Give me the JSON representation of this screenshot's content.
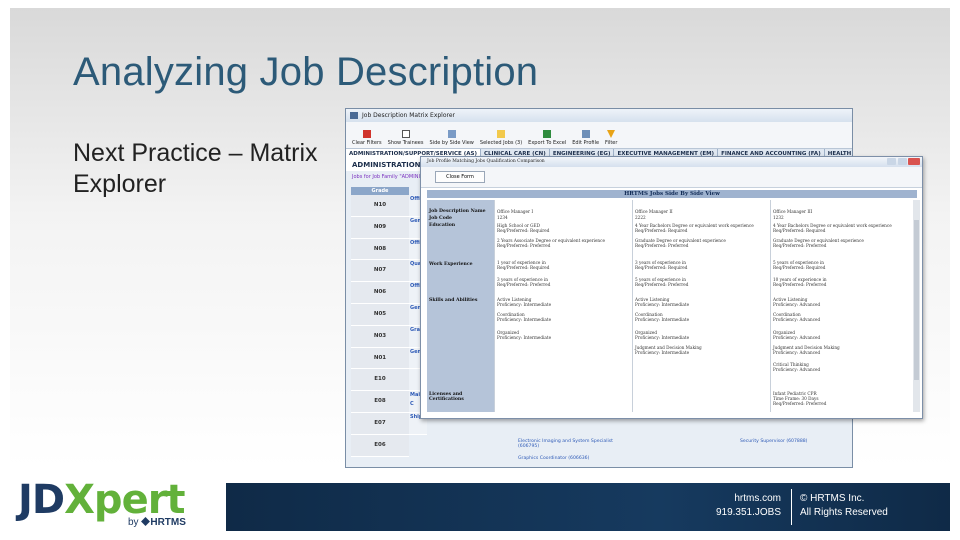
{
  "slide": {
    "title": "Analyzing Job Description",
    "subtitle": "Next Practice – Matrix Explorer"
  },
  "window": {
    "title": "Job Description Matrix Explorer",
    "toolbar": [
      "Clear Filters",
      "Show Trainees",
      "Side by Side View",
      "Selected Jobs (3)",
      "Export To Excel",
      "Edit Profile",
      "Filter"
    ],
    "tabs": [
      "ADMINISTRATION/SUPPORT/SERVICE (AS)",
      "CLINICAL CARE (CN)",
      "ENGINEERING (EG)",
      "EXECUTIVE MANAGEMENT (EM)",
      "FINANCE AND ACCOUNTING (FA)",
      "HEALTH AND ENVIRON"
    ],
    "section_heading": "ADMINISTRATION/",
    "family_line": "Jobs for Job Family \"ADMINIS",
    "grade_header": "Grade",
    "grades": [
      "N10",
      "N09",
      "N08",
      "N07",
      "N06",
      "N05",
      "N03",
      "N01",
      "E10",
      "E08",
      "E07",
      "E06"
    ],
    "job_snippets": [
      "Offic",
      "Gene",
      "Offic",
      "Quali",
      "Offic",
      "Gene",
      "Gran",
      "Gene",
      "",
      "Mail C",
      "Shipp",
      ""
    ],
    "bottom_jobs": [
      "Electronic Output Specialist (606750)",
      "Groundskeeper (005537)",
      "Electronic Imaging and System Specialist (606795)",
      "Security Supervisor (607888)",
      "Graphics Coordinator (606636)"
    ]
  },
  "popup": {
    "title": "Job Profile Matching Jobs Qualification Comparison",
    "close_label": "Close Form",
    "side_header": "HRTMS Jobs Side By Side View",
    "row_labels": [
      "Job Description Name",
      "Job Code",
      "Education",
      "Work Experience",
      "Skills and Abilities",
      "Licenses and Certifications"
    ],
    "columns": [
      {
        "lines": [
          "Office Manager I",
          "1234",
          "High School or GED",
          "Req/Preferred: Required",
          "2 Years Associate Degree or equivalent experience",
          "Req/Preferred: Preferred",
          "1 year of experience in",
          "Req/Preferred: Required",
          "3 years of experience in",
          "Req/Preferred: Preferred",
          "Active Listening",
          "Proficiency: Intermediate",
          "Coordination",
          "Proficiency: Intermediate",
          "Organized",
          "Proficiency: Intermediate"
        ]
      },
      {
        "lines": [
          "Office Manager II",
          "2222",
          "4 Year Bachelors Degree or equivalent work experience",
          "Req/Preferred: Required",
          "Graduate Degree or equivalent experience",
          "Req/Preferred: Preferred",
          "3 years of experience in",
          "Req/Preferred: Required",
          "5 years of experience in",
          "Req/Preferred: Preferred",
          "Active Listening",
          "Proficiency: Intermediate",
          "Coordination",
          "Proficiency: Intermediate",
          "Organized",
          "Proficiency: Intermediate",
          "Judgment and Decision Making",
          "Proficiency: Intermediate"
        ]
      },
      {
        "lines": [
          "Office Manager III",
          "1232",
          "4 Year Bachelors Degree or equivalent work experience",
          "Req/Preferred: Required",
          "Graduate Degree or equivalent experience",
          "Req/Preferred: Preferred",
          "5 years of experience in",
          "Req/Preferred: Required",
          "10 years of experience in",
          "Req/Preferred: Preferred",
          "Active Listening",
          "Proficiency: Advanced",
          "Coordination",
          "Proficiency: Advanced",
          "Organized",
          "Proficiency: Advanced",
          "Judgment and Decision Making",
          "Proficiency: Advanced",
          "Critical Thinking",
          "Proficiency: Advanced",
          "Infant Pediatric CPR",
          "Time Frame: 30 Days",
          "Req/Preferred: Preferred"
        ]
      }
    ]
  },
  "footer": {
    "logo_text": "JDXpert",
    "logo_by": "by",
    "logo_brand": "HRTMS",
    "website": "hrtms.com",
    "phone": "919.351.JOBS",
    "copyright": "© HRTMS Inc.",
    "rights": "All Rights Reserved"
  },
  "colors": {
    "title": "#2c5a78",
    "logo_jd": "#1f3b63",
    "logo_xpert": "#62b13a",
    "footer_bar": "#163a5f"
  }
}
